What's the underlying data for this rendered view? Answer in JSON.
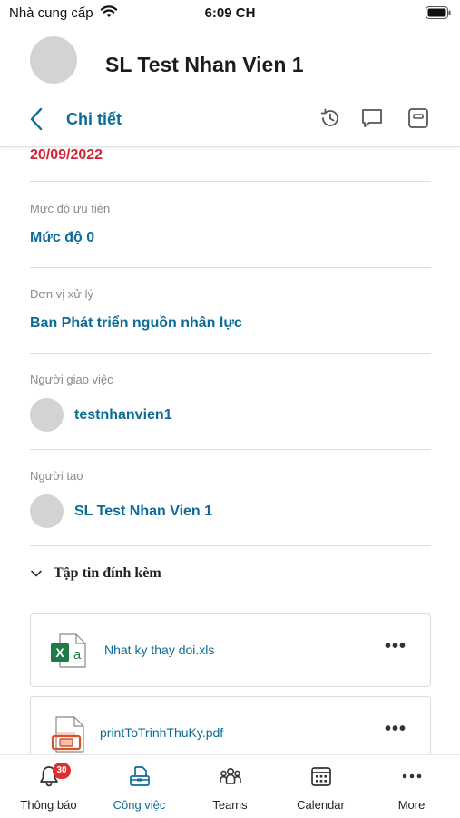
{
  "status_bar": {
    "carrier": "Nhà cung cấp",
    "time": "6:09 CH"
  },
  "header": {
    "title": "SL Test Nhan Vien 1",
    "nav_title": "Chi tiết",
    "icons": [
      "history-icon",
      "comment-icon",
      "archive-icon"
    ]
  },
  "details": {
    "date_value": "20/09/2022",
    "priority_label": "Mức độ ưu tiên",
    "priority_value": "Mức độ 0",
    "unit_label": "Đơn vị xử lý",
    "unit_value": "Ban Phát triển nguồn nhân lực",
    "assigner_label": "Người giao việc",
    "assigner_name": "testnhanvien1",
    "creator_label": "Người tạo",
    "creator_name": "SL Test Nhan Vien 1"
  },
  "attachments": {
    "title": "Tập tin đính kèm",
    "files": [
      {
        "name": "Nhat ky thay doi.xls",
        "type": "excel",
        "more": "•••"
      },
      {
        "name": "printToTrinhThuKy.pdf",
        "type": "pdf",
        "more": "•••"
      }
    ]
  },
  "tabbar": {
    "tabs": [
      {
        "label": "Thông báo",
        "icon": "bell-icon",
        "badge": "30"
      },
      {
        "label": "Công việc",
        "icon": "tasks-icon",
        "active": true
      },
      {
        "label": "Teams",
        "icon": "teams-icon"
      },
      {
        "label": "Calendar",
        "icon": "calendar-icon"
      },
      {
        "label": "More",
        "icon": "more-icon"
      }
    ]
  },
  "colors": {
    "accent": "#0c6c96",
    "date": "#d3253a",
    "badge": "#e0302e"
  }
}
